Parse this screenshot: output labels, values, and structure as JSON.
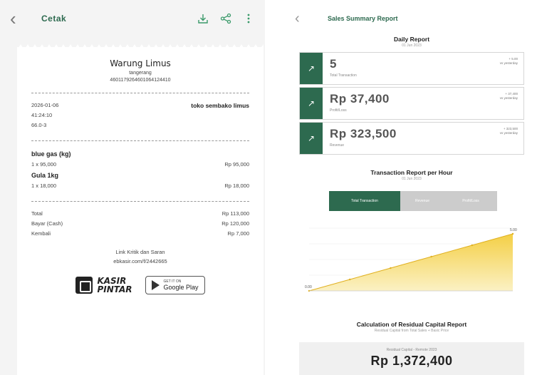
{
  "left": {
    "header": {
      "title": "Cetak"
    },
    "receipt": {
      "store_name": "Warung Limus",
      "city": "tangerang",
      "code": "4601179264601064124410",
      "date": "2026-01-06",
      "shop_type": "toko sembako limus",
      "time": "41:24:10",
      "trx_id": "66.0-3",
      "items": [
        {
          "name": "blue gas (kg)",
          "qty": "1 x 95,000",
          "total": "Rp 95,000"
        },
        {
          "name": "Gula 1kg",
          "qty": "1 x 18,000",
          "total": "Rp 18,000"
        }
      ],
      "summary": [
        {
          "label": "Total",
          "value": "Rp 113,000"
        },
        {
          "label": "Bayar (Cash)",
          "value": "Rp 120,000"
        },
        {
          "label": "Kembali",
          "value": "Rp 7,000"
        }
      ],
      "footer_line1": "Link Kritik dan Saran",
      "footer_line2": "ebkasir.com/f/2442665",
      "brand_line1": "KASIR",
      "brand_line2": "PINTAR",
      "store_badge_small": "GET IT ON",
      "store_badge_big": "Google Play"
    }
  },
  "right": {
    "header": {
      "title": "Sales Summary Report"
    },
    "daily": {
      "title": "Daily Report",
      "subtitle": "01 Jun 2023",
      "cards": [
        {
          "value": "5",
          "label": "Total Transaction",
          "right_top": "+ 5.00",
          "right_bottom": "vs yesterday"
        },
        {
          "value": "Rp 37,400",
          "label": "Profit/Loss",
          "right_top": "+ 37,400",
          "right_bottom": "vs yesterday"
        },
        {
          "value": "Rp 323,500",
          "label": "Revenue",
          "right_top": "+ 323,500",
          "right_bottom": "vs yesterday"
        }
      ]
    },
    "hourly": {
      "title": "Transaction Report per Hour",
      "subtitle": "01 Jun 2023",
      "tabs": [
        "Total Transaction",
        "Revenue",
        "Profit/Loss"
      ]
    },
    "capital": {
      "title": "Calculation of Residual Capital Report",
      "subtitle": "Residual Capital from Total Sales + Basic Price",
      "label": "Residual Capital - Remote 2023",
      "value": "Rp 1,372,400"
    },
    "chart_data": {
      "type": "area",
      "x": [
        "",
        "",
        "",
        "",
        "",
        ""
      ],
      "series": [
        {
          "values": [
            0,
            1,
            2,
            3,
            4,
            5
          ]
        }
      ],
      "start_label": "0.00",
      "end_label": "5.00",
      "ylim": [
        0,
        5.5
      ],
      "fill_color": "#f4cf45"
    }
  }
}
